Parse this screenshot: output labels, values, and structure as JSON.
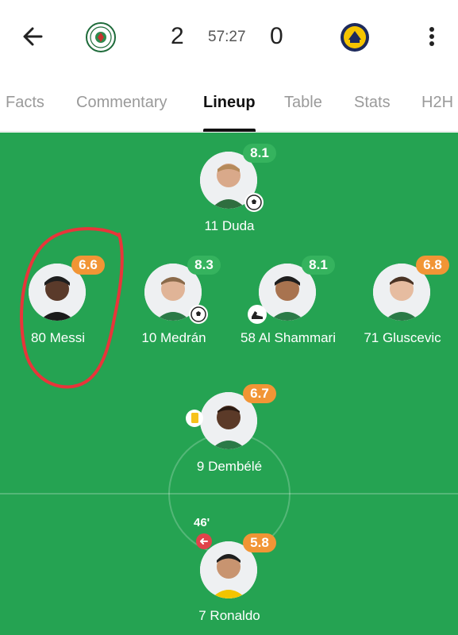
{
  "match": {
    "home_score": "2",
    "away_score": "0",
    "clock": "57:27"
  },
  "tabs": [
    {
      "label": "Facts"
    },
    {
      "label": "Commentary"
    },
    {
      "label": "Lineup"
    },
    {
      "label": "Table"
    },
    {
      "label": "Stats"
    },
    {
      "label": "H2H"
    }
  ],
  "active_tab": "Lineup",
  "colors": {
    "pitch": "#25a352",
    "rating_green": "#35b35e",
    "rating_orange": "#f19535",
    "highlight_circle": "#e8353a",
    "sub_marker": "#e0434a"
  },
  "players": [
    {
      "name": "11 Duda",
      "rating": "8.1",
      "rating_color": "green",
      "events": [
        "goal-ball-icon"
      ]
    },
    {
      "name": "80 Messi",
      "rating": "6.6",
      "rating_color": "orange",
      "events": []
    },
    {
      "name": "10 Medrán",
      "rating": "8.3",
      "rating_color": "green",
      "events": [
        "goal-ball-icon"
      ]
    },
    {
      "name": "58 Al Shammari",
      "rating": "8.1",
      "rating_color": "green",
      "events": [
        "assist-boot-icon"
      ]
    },
    {
      "name": "71 Gluscevic",
      "rating": "6.8",
      "rating_color": "orange",
      "events": []
    },
    {
      "name": "9 Dembélé",
      "rating": "6.7",
      "rating_color": "orange",
      "events": [
        "yellow-card-icon"
      ]
    },
    {
      "name": "7 Ronaldo",
      "rating": "5.8",
      "rating_color": "orange",
      "events": [
        "substituted-out-icon"
      ],
      "sub_minute": "46'"
    }
  ]
}
